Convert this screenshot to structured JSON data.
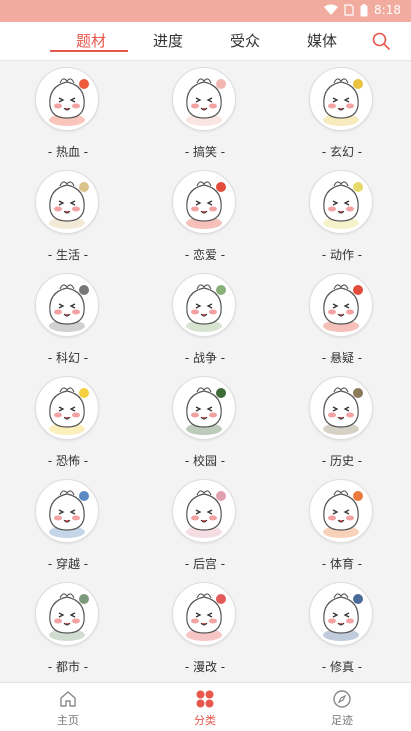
{
  "status": {
    "time": "8:18"
  },
  "tabs": [
    "题材",
    "进度",
    "受众",
    "媒体"
  ],
  "active_tab": "题材",
  "accent_color": "#e8574c",
  "search_icon": "search-icon",
  "categories": [
    {
      "label": "- 热血 -"
    },
    {
      "label": "- 搞笑 -"
    },
    {
      "label": "- 玄幻 -"
    },
    {
      "label": "- 生活 -"
    },
    {
      "label": "- 恋爱 -"
    },
    {
      "label": "- 动作 -"
    },
    {
      "label": "- 科幻 -"
    },
    {
      "label": "- 战争 -"
    },
    {
      "label": "- 悬疑 -"
    },
    {
      "label": "- 恐怖 -"
    },
    {
      "label": "- 校园 -"
    },
    {
      "label": "- 历史 -"
    },
    {
      "label": "- 穿越 -"
    },
    {
      "label": "- 后宫 -"
    },
    {
      "label": "- 体育 -"
    },
    {
      "label": "- 都市 -"
    },
    {
      "label": "- 漫改 -"
    },
    {
      "label": "- 修真 -"
    }
  ],
  "bottom_nav": [
    {
      "label": "主页",
      "icon": "home-icon"
    },
    {
      "label": "分类",
      "icon": "category-icon"
    },
    {
      "label": "足迹",
      "icon": "compass-icon"
    }
  ]
}
